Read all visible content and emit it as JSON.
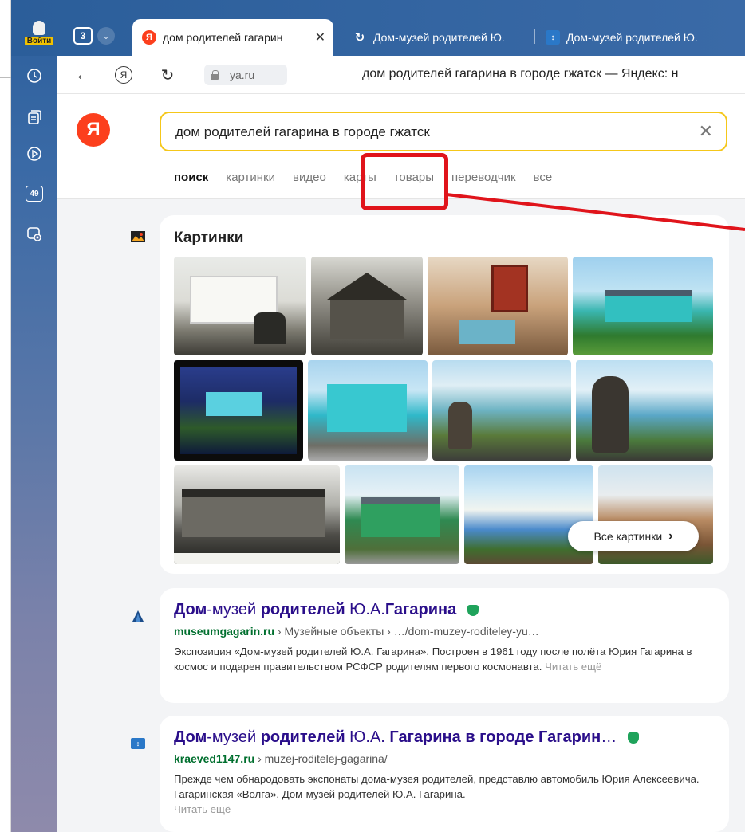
{
  "browser": {
    "login_label": "Войти",
    "tab_count": "3",
    "tabs": [
      {
        "title": "дом родителей гагарин",
        "active": true
      },
      {
        "title": "Дом-музей родителей Ю.",
        "active": false
      },
      {
        "title": "Дом-музей родителей Ю.",
        "active": false
      }
    ],
    "url": "ya.ru",
    "page_title": "дом родителей гагарина в городе гжатск — Яндекс: н",
    "sidebar_badge": "49"
  },
  "search": {
    "logo": "Я",
    "query": "дом родителей гагарина в городе гжатск",
    "tabs": [
      "поиск",
      "картинки",
      "видео",
      "карты",
      "товары",
      "переводчик",
      "все"
    ],
    "selected_tab": "поиск"
  },
  "images": {
    "title": "Картинки",
    "all_images_label": "Все картинки"
  },
  "results": [
    {
      "title_parts": [
        "Дом",
        "-музей ",
        "родителей",
        " Ю.А.",
        "Гагарина"
      ],
      "site": "museumgagarin.ru",
      "path": " › Музейные объекты › …/dom-muzey-roditeley-yu…",
      "snippet": "Экспозиция «Дом-музей родителей Ю.А. Гагарина». Построен в 1961 году после полёта Юрия Гагарина в космос и подарен правительством РСФСР родителям первого космонавта.",
      "more": "Читать ещё"
    },
    {
      "title_parts": [
        "Дом",
        "-музей ",
        "родителей",
        " Ю.А. ",
        "Гагарина в городе Гагарин",
        "…"
      ],
      "site": "kraeved1147.ru",
      "path": " › muzej-roditelej-gagarina/",
      "snippet": "Прежде чем обнародовать экспонаты дома-музея родителей, представлю автомобиль Юрия Алексеевича. Гагаринская «Волга». Дом-музей родителей Ю.А. Гагарина.",
      "more": "Читать ещё"
    }
  ],
  "colors": {
    "accent_yellow": "#f5c71a",
    "yandex_red": "#fc3f1d",
    "annotation_red": "#e0141b",
    "link_title": "#2a0e8a",
    "url_green": "#006f2e"
  }
}
